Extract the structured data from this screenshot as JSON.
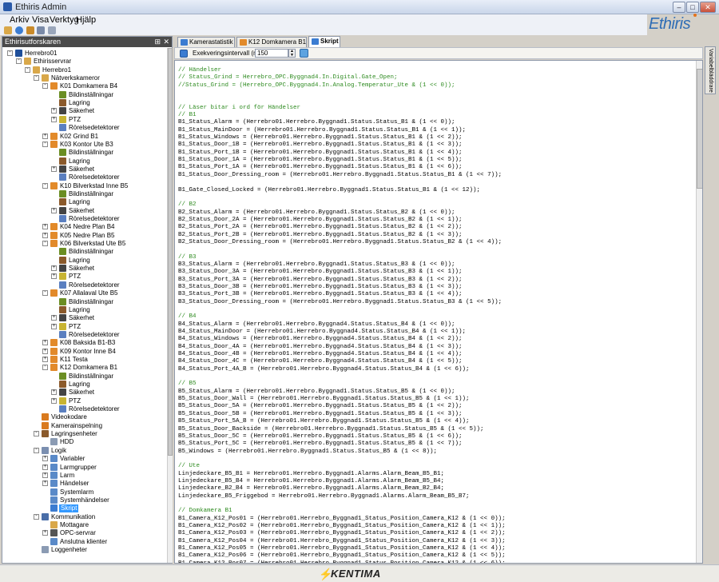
{
  "window": {
    "title": "Ethiris Admin",
    "minimize": "–",
    "maximize": "□",
    "close": "✕"
  },
  "menu": [
    "Arkiv",
    "Visa",
    "Verktyg",
    "Hjälp"
  ],
  "logo": "Ethiris",
  "explorer": {
    "title": "Ethirisutforskaren",
    "pin": "⊞",
    "close": "✕",
    "nodes": [
      {
        "label": "Herrebro01",
        "d": 0,
        "e": "-",
        "icon": "server-icon",
        "c": "#1f4f9a"
      },
      {
        "label": "Ethirisservrar",
        "d": 1,
        "e": "-",
        "icon": "folder-icon",
        "c": "#d9a84a"
      },
      {
        "label": "Herrebro1",
        "d": 2,
        "e": "-",
        "icon": "computer-icon",
        "c": "#d9a84a"
      },
      {
        "label": "Nätverkskameror",
        "d": 3,
        "e": "-",
        "icon": "folder-icon",
        "c": "#d9a84a"
      },
      {
        "label": "K01 Domkamera B4",
        "d": 4,
        "e": "-",
        "icon": "camera-icon",
        "c": "#e28a2a"
      },
      {
        "label": "Bildinställningar",
        "d": 5,
        "e": "",
        "icon": "image-icon",
        "c": "#6b8e23"
      },
      {
        "label": "Lagring",
        "d": 5,
        "e": "",
        "icon": "storage-icon",
        "c": "#8b5a2b"
      },
      {
        "label": "Säkerhet",
        "d": 5,
        "e": "+",
        "icon": "security-icon",
        "c": "#444"
      },
      {
        "label": "PTZ",
        "d": 5,
        "e": "+",
        "icon": "ptz-icon",
        "c": "#c8b432"
      },
      {
        "label": "Rörelsedetektorer",
        "d": 5,
        "e": "",
        "icon": "motion-icon",
        "c": "#5a7fc0"
      },
      {
        "label": "K02 Grind B1",
        "d": 4,
        "e": "+",
        "icon": "camera-icon",
        "c": "#e28a2a"
      },
      {
        "label": "K03 Kontor Ute B3",
        "d": 4,
        "e": "-",
        "icon": "camera-icon",
        "c": "#e28a2a"
      },
      {
        "label": "Bildinställningar",
        "d": 5,
        "e": "",
        "icon": "image-icon",
        "c": "#6b8e23"
      },
      {
        "label": "Lagring",
        "d": 5,
        "e": "",
        "icon": "storage-icon",
        "c": "#8b5a2b"
      },
      {
        "label": "Säkerhet",
        "d": 5,
        "e": "+",
        "icon": "security-icon",
        "c": "#444"
      },
      {
        "label": "Rörelsedetektorer",
        "d": 5,
        "e": "",
        "icon": "motion-icon",
        "c": "#5a7fc0"
      },
      {
        "label": "K10 Bilverkstad Inne B5",
        "d": 4,
        "e": "-",
        "icon": "camera-icon",
        "c": "#e28a2a"
      },
      {
        "label": "Bildinställningar",
        "d": 5,
        "e": "",
        "icon": "image-icon",
        "c": "#6b8e23"
      },
      {
        "label": "Lagring",
        "d": 5,
        "e": "",
        "icon": "storage-icon",
        "c": "#8b5a2b"
      },
      {
        "label": "Säkerhet",
        "d": 5,
        "e": "+",
        "icon": "security-icon",
        "c": "#444"
      },
      {
        "label": "Rörelsedetektorer",
        "d": 5,
        "e": "",
        "icon": "motion-icon",
        "c": "#5a7fc0"
      },
      {
        "label": "K04 Nedre Plan B4",
        "d": 4,
        "e": "+",
        "icon": "camera-icon",
        "c": "#e28a2a"
      },
      {
        "label": "K05 Nedre Plan B5",
        "d": 4,
        "e": "+",
        "icon": "camera-icon",
        "c": "#e28a2a"
      },
      {
        "label": "K06 Bilverkstad Ute B5",
        "d": 4,
        "e": "-",
        "icon": "camera-icon",
        "c": "#e28a2a"
      },
      {
        "label": "Bildinställningar",
        "d": 5,
        "e": "",
        "icon": "image-icon",
        "c": "#6b8e23"
      },
      {
        "label": "Lagring",
        "d": 5,
        "e": "",
        "icon": "storage-icon",
        "c": "#8b5a2b"
      },
      {
        "label": "Säkerhet",
        "d": 5,
        "e": "+",
        "icon": "security-icon",
        "c": "#444"
      },
      {
        "label": "PTZ",
        "d": 5,
        "e": "+",
        "icon": "ptz-icon",
        "c": "#c8b432"
      },
      {
        "label": "Rörelsedetektorer",
        "d": 5,
        "e": "",
        "icon": "motion-icon",
        "c": "#5a7fc0"
      },
      {
        "label": "K07 Allalaval Ute B5",
        "d": 4,
        "e": "-",
        "icon": "camera-icon",
        "c": "#e28a2a"
      },
      {
        "label": "Bildinställningar",
        "d": 5,
        "e": "",
        "icon": "image-icon",
        "c": "#6b8e23"
      },
      {
        "label": "Lagring",
        "d": 5,
        "e": "",
        "icon": "storage-icon",
        "c": "#8b5a2b"
      },
      {
        "label": "Säkerhet",
        "d": 5,
        "e": "+",
        "icon": "security-icon",
        "c": "#444"
      },
      {
        "label": "PTZ",
        "d": 5,
        "e": "+",
        "icon": "ptz-icon",
        "c": "#c8b432"
      },
      {
        "label": "Rörelsedetektorer",
        "d": 5,
        "e": "",
        "icon": "motion-icon",
        "c": "#5a7fc0"
      },
      {
        "label": "K08 Baksida B1-B3",
        "d": 4,
        "e": "+",
        "icon": "camera-icon",
        "c": "#e28a2a"
      },
      {
        "label": "K09 Kontor Inne B4",
        "d": 4,
        "e": "+",
        "icon": "camera-icon",
        "c": "#e28a2a"
      },
      {
        "label": "K11 Testa",
        "d": 4,
        "e": "+",
        "icon": "camera-icon",
        "c": "#e28a2a"
      },
      {
        "label": "K12 Domkamera B1",
        "d": 4,
        "e": "-",
        "icon": "camera-icon",
        "c": "#e28a2a"
      },
      {
        "label": "Bildinställningar",
        "d": 5,
        "e": "",
        "icon": "image-icon",
        "c": "#6b8e23"
      },
      {
        "label": "Lagring",
        "d": 5,
        "e": "",
        "icon": "storage-icon",
        "c": "#8b5a2b"
      },
      {
        "label": "Säkerhet",
        "d": 5,
        "e": "+",
        "icon": "security-icon",
        "c": "#444"
      },
      {
        "label": "PTZ",
        "d": 5,
        "e": "+",
        "icon": "ptz-icon",
        "c": "#c8b432"
      },
      {
        "label": "Rörelsedetektorer",
        "d": 5,
        "e": "",
        "icon": "motion-icon",
        "c": "#5a7fc0"
      },
      {
        "label": "Videokodare",
        "d": 3,
        "e": "",
        "icon": "encoder-icon",
        "c": "#d97a1e"
      },
      {
        "label": "Kamerainspelning",
        "d": 3,
        "e": "",
        "icon": "recording-icon",
        "c": "#d97a1e"
      },
      {
        "label": "Lagringsenheter",
        "d": 3,
        "e": "-",
        "icon": "storage-icon",
        "c": "#8b5a2b"
      },
      {
        "label": "HDD",
        "d": 4,
        "e": "",
        "icon": "hdd-icon",
        "c": "#8b9bb3"
      },
      {
        "label": "Logik",
        "d": 3,
        "e": "-",
        "icon": "logic-icon",
        "c": "#7b8fb0"
      },
      {
        "label": "Variabler",
        "d": 4,
        "e": "+",
        "icon": "variables-icon",
        "c": "#5a8ac8"
      },
      {
        "label": "Larmgrupper",
        "d": 4,
        "e": "+",
        "icon": "alarm-groups-icon",
        "c": "#5a8ac8"
      },
      {
        "label": "Larm",
        "d": 4,
        "e": "+",
        "icon": "alarm-icon",
        "c": "#5a8ac8"
      },
      {
        "label": "Händelser",
        "d": 4,
        "e": "+",
        "icon": "events-icon",
        "c": "#5a8ac8"
      },
      {
        "label": "Systemlarm",
        "d": 4,
        "e": "",
        "icon": "system-alarm-icon",
        "c": "#5a8ac8"
      },
      {
        "label": "Systemhändelser",
        "d": 4,
        "e": "",
        "icon": "system-events-icon",
        "c": "#5a8ac8"
      },
      {
        "label": "Skript",
        "d": 4,
        "e": "",
        "icon": "script-icon",
        "c": "#3b7cd1",
        "sel": true
      },
      {
        "label": "Kommunikation",
        "d": 3,
        "e": "-",
        "icon": "communication-icon",
        "c": "#4a6ea8"
      },
      {
        "label": "Mottagare",
        "d": 4,
        "e": "",
        "icon": "receiver-icon",
        "c": "#d9a84a"
      },
      {
        "label": "OPC-servrar",
        "d": 4,
        "e": "+",
        "icon": "opc-server-icon",
        "c": "#555"
      },
      {
        "label": "Anslutna klienter",
        "d": 4,
        "e": "",
        "icon": "clients-icon",
        "c": "#5a8ac8"
      },
      {
        "label": "Loggenheter",
        "d": 3,
        "e": "",
        "icon": "log-icon",
        "c": "#8b9bb3"
      }
    ]
  },
  "tabs": [
    {
      "label": "Kamerastatistik",
      "icon": "statistics-icon",
      "c": "#3b7cd1"
    },
    {
      "label": "K12 Domkamera B1",
      "icon": "camera-icon",
      "c": "#e28a2a"
    },
    {
      "label": "Skript",
      "icon": "script-icon",
      "c": "#3b7cd1",
      "active": true
    }
  ],
  "exec": {
    "label": "Exekveringsintervall (ms):",
    "value": "150"
  },
  "side_panel": "Variabelbläddrare",
  "code": [
    "// Händelser",
    "// Status_Grind = Herrebro_OPC.Byggnad4.In.Digital.Gate_Open;",
    "//Status_Grind = (Herrebro_OPC.Byggnad4.In.Analog.Temperatur_Ute & (1 << 0));",
    "",
    "",
    "// Läser bitar i ord för Händelser",
    "// B1",
    "B1_Status_Alarm = (Herrebro01.Herrebro.Byggnad1.Status.Status_B1 & (1 << 0));",
    "B1_Status_MainDoor = (Herrebro01.Herrebro.Byggnad1.Status.Status_B1 & (1 << 1));",
    "B1_Status_Windows = (Herrebro01.Herrebro.Byggnad1.Status.Status_B1 & (1 << 2));",
    "B1_Status_Door_1B = (Herrebro01.Herrebro.Byggnad1.Status.Status_B1 & (1 << 3));",
    "B1_Status_Port_1B = (Herrebro01.Herrebro.Byggnad1.Status.Status_B1 & (1 << 4));",
    "B1_Status_Door_1A = (Herrebro01.Herrebro.Byggnad1.Status.Status_B1 & (1 << 5));",
    "B1_Status_Port_1A = (Herrebro01.Herrebro.Byggnad1.Status.Status_B1 & (1 << 6));",
    "B1_Status_Door_Dressing_room = (Herrebro01.Herrebro.Byggnad1.Status.Status_B1 & (1 << 7));",
    "",
    "B1_Gate_Closed_Locked = (Herrebro01.Herrebro.Byggnad1.Status.Status_B1 & (1 << 12));",
    "",
    "// B2",
    "B2_Status_Alarm = (Herrebro01.Herrebro.Byggnad1.Status.Status_B2 & (1 << 0));",
    "B2_Status_Door_2A = (Herrebro01.Herrebro.Byggnad1.Status.Status_B2 & (1 << 1));",
    "B2_Status_Port_2A = (Herrebro01.Herrebro.Byggnad1.Status.Status_B2 & (1 << 2));",
    "B2_Status_Port_2B = (Herrebro01.Herrebro.Byggnad1.Status.Status_B2 & (1 << 3));",
    "B2_Status_Door_Dressing_room = (Herrebro01.Herrebro.Byggnad1.Status.Status_B2 & (1 << 4));",
    "",
    "// B3",
    "B3_Status_Alarm = (Herrebro01.Herrebro.Byggnad1.Status.Status_B3 & (1 << 0));",
    "B3_Status_Door_3A = (Herrebro01.Herrebro.Byggnad1.Status.Status_B3 & (1 << 1));",
    "B3_Status_Port_3A = (Herrebro01.Herrebro.Byggnad1.Status.Status_B3 & (1 << 2));",
    "B3_Status_Door_3B = (Herrebro01.Herrebro.Byggnad1.Status.Status_B3 & (1 << 3));",
    "B3_Status_Port_3B = (Herrebro01.Herrebro.Byggnad1.Status.Status_B3 & (1 << 4));",
    "B3_Status_Door_Dressing_room = (Herrebro01.Herrebro.Byggnad1.Status.Status_B3 & (1 << 5));",
    "",
    "// B4",
    "B4_Status_Alarm = (Herrebro01.Herrebro.Byggnad4.Status.Status_B4 & (1 << 0));",
    "B4_Status_MainDoor = (Herrebro01.Herrebro.Byggnad4.Status.Status_B4 & (1 << 1));",
    "B4_Status_Windows = (Herrebro01.Herrebro.Byggnad4.Status.Status_B4 & (1 << 2));",
    "B4_Status_Door_4A = (Herrebro01.Herrebro.Byggnad4.Status.Status_B4 & (1 << 3));",
    "B4_Status_Door_4B = (Herrebro01.Herrebro.Byggnad4.Status.Status_B4 & (1 << 4));",
    "B4_Status_Door_4C = (Herrebro01.Herrebro.Byggnad4.Status.Status_B4 & (1 << 5));",
    "B4_Status_Port_4A_B = (Herrebro01.Herrebro.Byggnad4.Status.Status_B4 & (1 << 6));",
    "",
    "// B5",
    "B5_Status_Alarm = (Herrebro01.Herrebro.Byggnad1.Status.Status_B5 & (1 << 0));",
    "B5_Status_Door_Wall = (Herrebro01.Herrebro.Byggnad1.Status.Status_B5 & (1 << 1));",
    "B5_Status_Door_5A = (Herrebro01.Herrebro.Byggnad1.Status.Status_B5 & (1 << 2));",
    "B5_Status_Door_5B = (Herrebro01.Herrebro.Byggnad1.Status.Status_B5 & (1 << 3));",
    "B5_Status_Port_5A_B = (Herrebro01.Herrebro.Byggnad1.Status.Status_B5 & (1 << 4));",
    "B5_Status_Door_Backside = (Herrebro01.Herrebro.Byggnad1.Status.Status_B5 & (1 << 5));",
    "B5_Status_Door_5C = (Herrebro01.Herrebro.Byggnad1.Status.Status_B5 & (1 << 6));",
    "B5_Status_Port_5C = (Herrebro01.Herrebro.Byggnad1.Status.Status_B5 & (1 << 7));",
    "B5_Windows = (Herrebro01.Herrebro.Byggnad1.Status.Status_B5 & (1 << 8));",
    "",
    "// Ute",
    "Linjedeckare_B5_B1 = Herrebro01.Herrebro.Byggnad1.Alarms.Alarm_Beam_B5_B1;",
    "Linjedeckare_B5_B4 = Herrebro01.Herrebro.Byggnad1.Alarms.Alarm_Beam_B5_B4;",
    "Linjedeckare_B2_B4 = Herrebro01.Herrebro.Byggnad1.Alarms.Alarm_Beam_B2_B4;",
    "Linjedeckare_B5_Friggebod = Herrebro01.Herrebro.Byggnad1.Alarms.Alarm_Beam_B5_B7;",
    "",
    "// Domkamera B1",
    "B1_Camera_K12_Pos01 = (Herrebro01.Herrebro_Byggnad1_Status_Position_Camera_K12 & (1 << 0));",
    "B1_Camera_K12_Pos02 = (Herrebro01.Herrebro_Byggnad1_Status_Position_Camera_K12 & (1 << 1));",
    "B1_Camera_K12_Pos03 = (Herrebro01.Herrebro_Byggnad1_Status_Position_Camera_K12 & (1 << 2));",
    "B1_Camera_K12_Pos04 = (Herrebro01.Herrebro_Byggnad1_Status_Position_Camera_K12 & (1 << 3));",
    "B1_Camera_K12_Pos05 = (Herrebro01.Herrebro_Byggnad1_Status_Position_Camera_K12 & (1 << 4));",
    "B1_Camera_K12_Pos06 = (Herrebro01.Herrebro_Byggnad1_Status_Position_Camera_K12 & (1 << 5));",
    "B1_Camera_K12_Pos07 = (Herrebro01.Herrebro_Byggnad1_Status_Position_Camera_K12 & (1 << 6));"
  ],
  "footer_brand": "KENTIMA"
}
